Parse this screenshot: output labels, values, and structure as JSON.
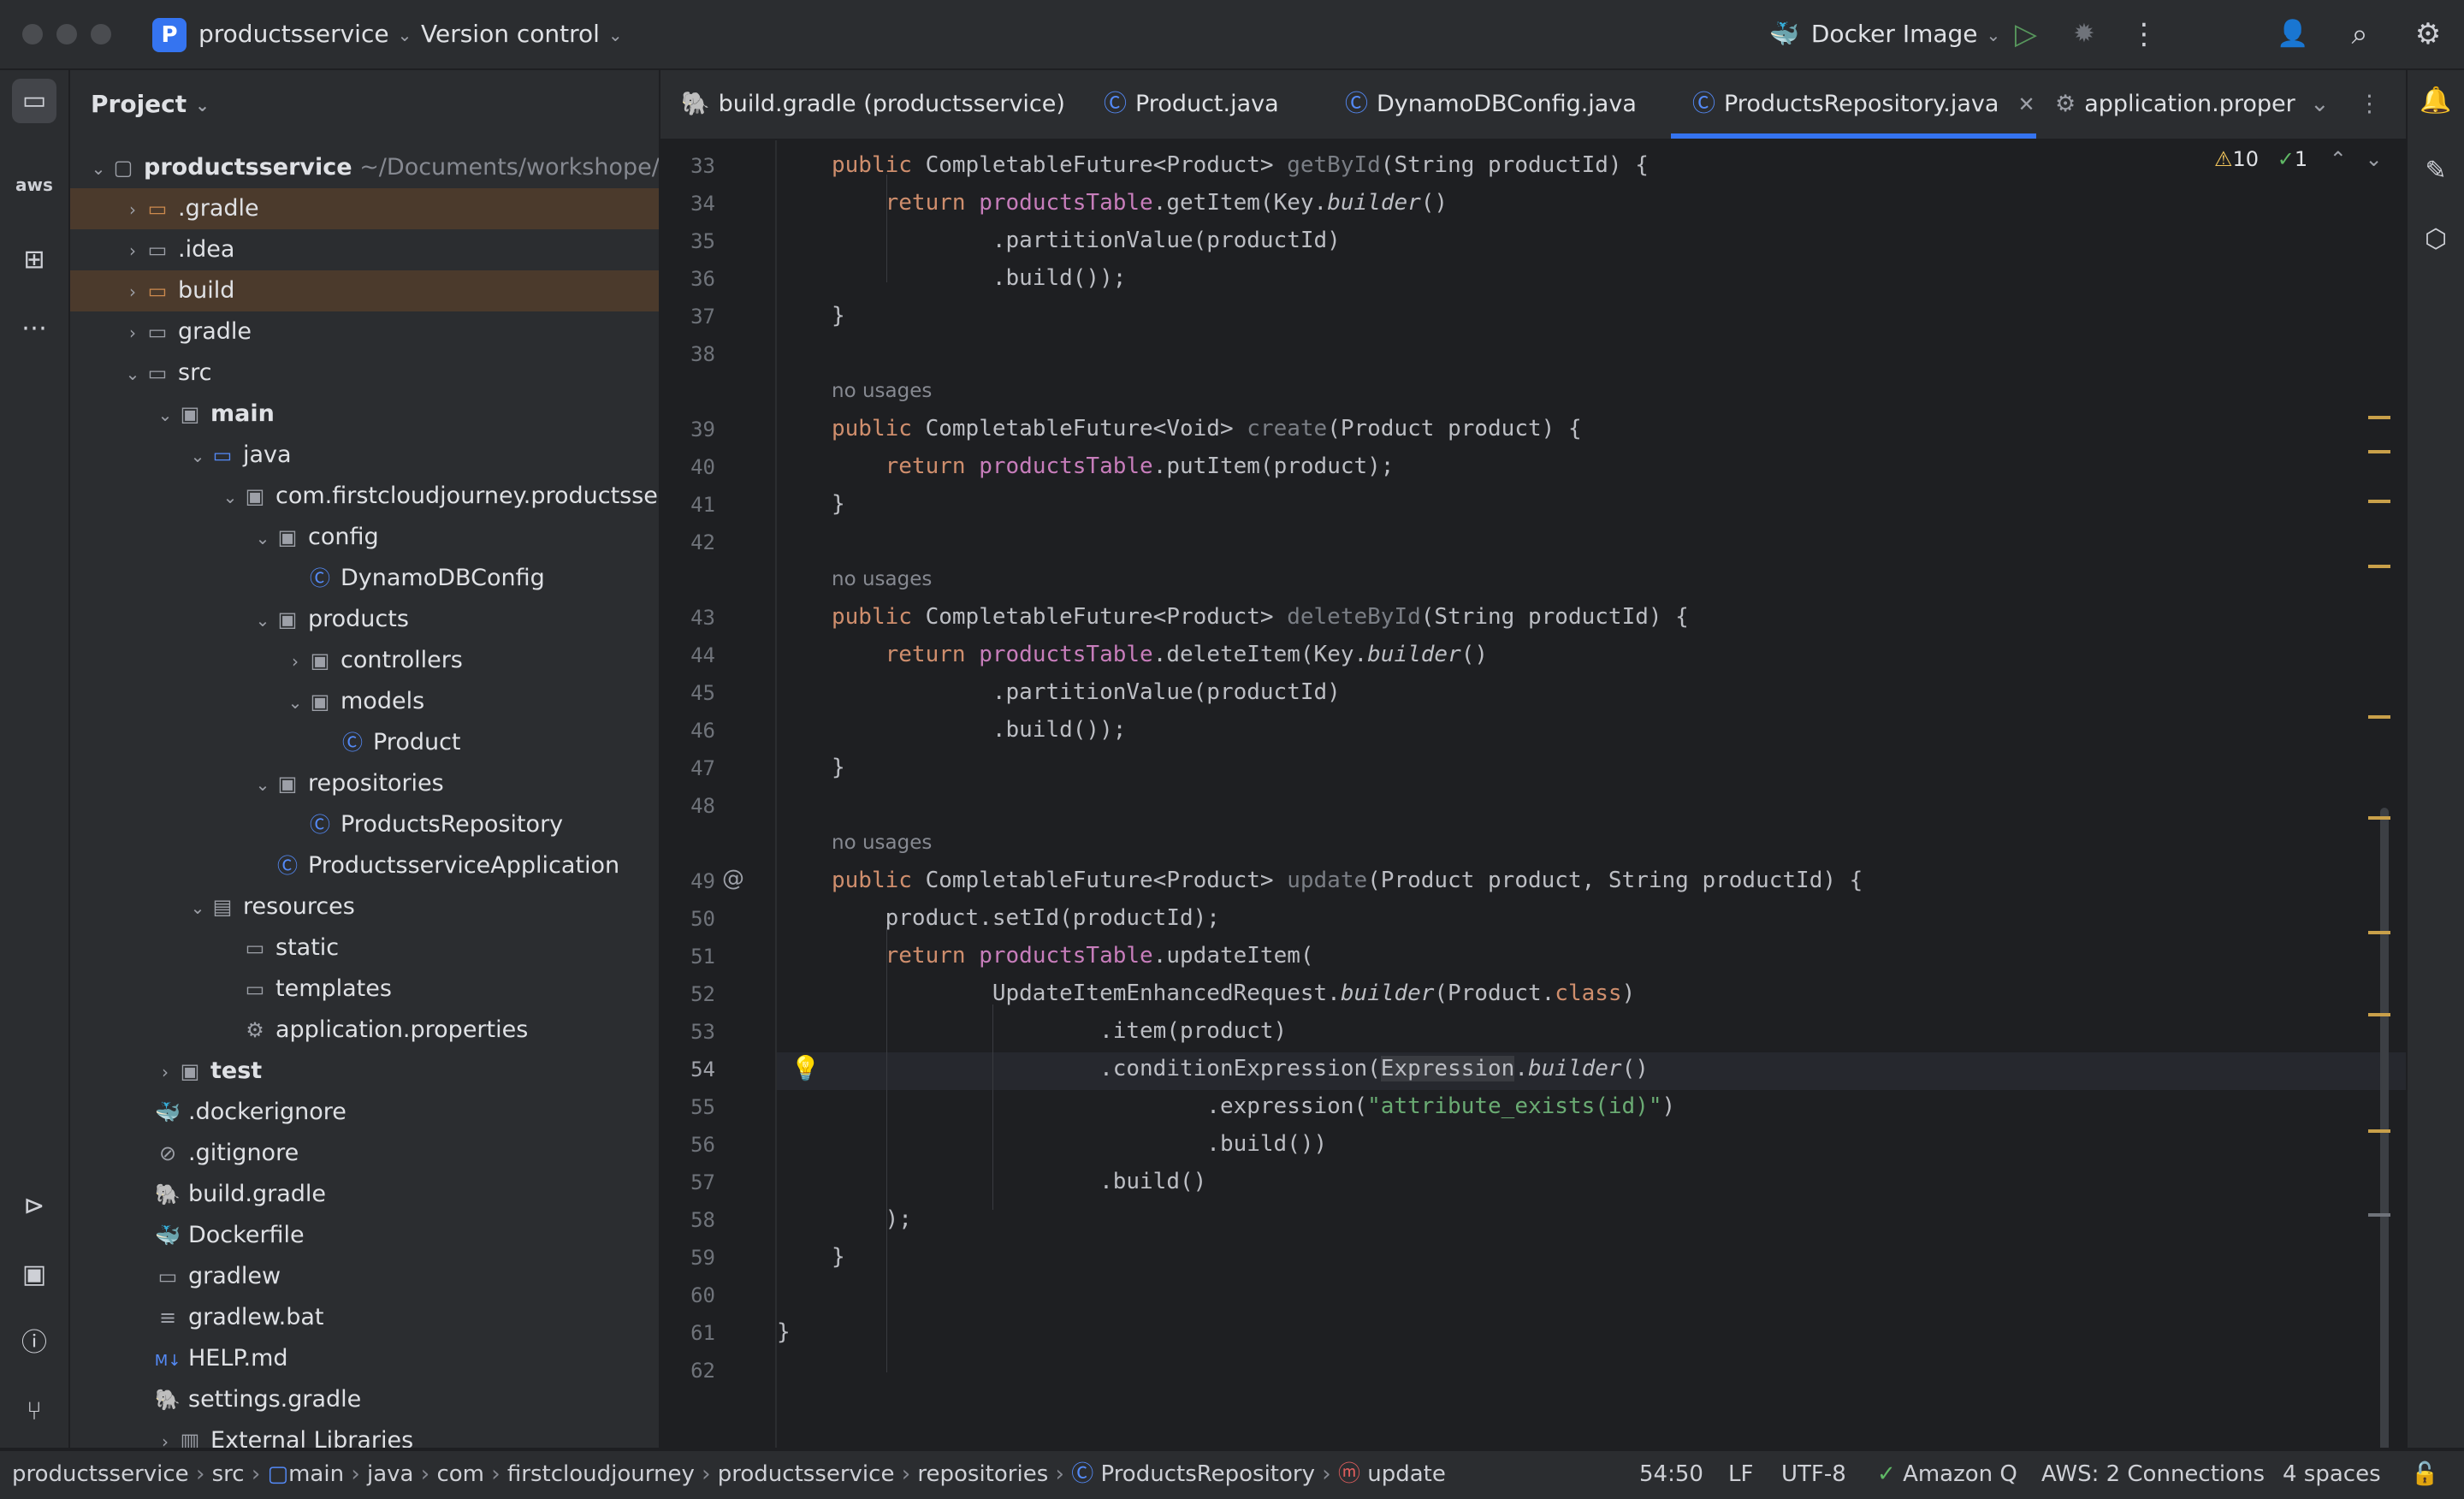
{
  "titlebar": {
    "project_badge": "P",
    "project_name": "productsservice",
    "vcs": "Version control",
    "run_config": "Docker Image"
  },
  "project_panel": {
    "title": "Project",
    "root_name": "productsservice",
    "root_path": "~/Documents/workshope/pro",
    "items": [
      {
        "label": ".gradle"
      },
      {
        "label": ".idea"
      },
      {
        "label": "build"
      },
      {
        "label": "gradle"
      },
      {
        "label": "src"
      },
      {
        "label": "main"
      },
      {
        "label": "java"
      },
      {
        "label": "com.firstcloudjourney.productsserv"
      },
      {
        "label": "config"
      },
      {
        "label": "DynamoDBConfig"
      },
      {
        "label": "products"
      },
      {
        "label": "controllers"
      },
      {
        "label": "models"
      },
      {
        "label": "Product"
      },
      {
        "label": "repositories"
      },
      {
        "label": "ProductsRepository"
      },
      {
        "label": "ProductsserviceApplication"
      },
      {
        "label": "resources"
      },
      {
        "label": "static"
      },
      {
        "label": "templates"
      },
      {
        "label": "application.properties"
      },
      {
        "label": "test"
      },
      {
        "label": ".dockerignore"
      },
      {
        "label": ".gitignore"
      },
      {
        "label": "build.gradle"
      },
      {
        "label": "Dockerfile"
      },
      {
        "label": "gradlew"
      },
      {
        "label": "gradlew.bat"
      },
      {
        "label": "HELP.md"
      },
      {
        "label": "settings.gradle"
      },
      {
        "label": "External Libraries"
      }
    ]
  },
  "tabs": [
    {
      "label": "build.gradle (productsservice)"
    },
    {
      "label": "Product.java"
    },
    {
      "label": "DynamoDBConfig.java"
    },
    {
      "label": "ProductsRepository.java"
    },
    {
      "label": "application.proper"
    }
  ],
  "inspections": {
    "warnings": "10",
    "ok": "1"
  },
  "editor": {
    "line_numbers": [
      "33",
      "34",
      "35",
      "36",
      "37",
      "38",
      "39",
      "40",
      "41",
      "42",
      "43",
      "44",
      "45",
      "46",
      "47",
      "48",
      "49",
      "50",
      "51",
      "52",
      "53",
      "54",
      "55",
      "56",
      "57",
      "58",
      "59",
      "60",
      "61",
      "62"
    ],
    "usage_hint": "no usages"
  },
  "statusbar": {
    "breadcrumb": [
      "productsservice",
      "src",
      "main",
      "java",
      "com",
      "firstcloudjourney",
      "productsservice",
      "repositories",
      "ProductsRepository",
      "update"
    ],
    "position": "54:50",
    "line_sep": "LF",
    "encoding": "UTF-8",
    "amazon_q": "Amazon Q",
    "aws": "AWS: 2 Connections",
    "indent": "4 spaces"
  }
}
